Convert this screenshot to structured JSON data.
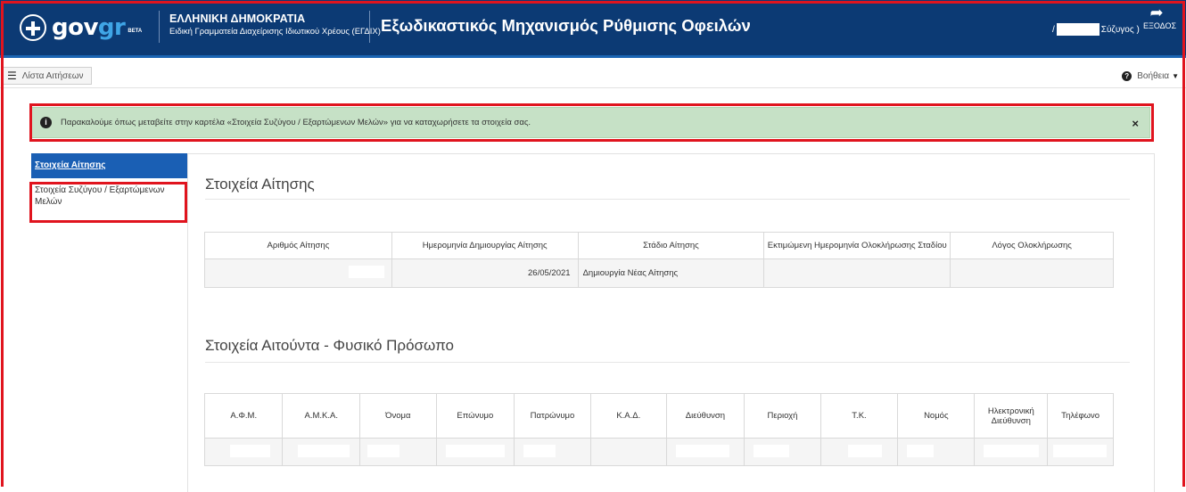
{
  "header": {
    "logo_gov": "gov",
    "logo_gr": "gr",
    "logo_beta": "BETA",
    "republic_title": "ΕΛΛΗΝΙΚΗ ΔΗΜΟΚΡΑΤΙΑ",
    "republic_subtitle": "Ειδική Γραμματεία Διαχείρισης Ιδιωτικού Χρέους (ΕΓΔΙΧ)",
    "app_title": "Εξωδικαστικός Μηχανισμός Ρύθμισης Οφειλών",
    "user_prefix": "/",
    "user_suffix": "Σύζυγος )",
    "logout_label": "ΕΞΟΔΟΣ",
    "logout_icon": "logout-icon",
    "colors": {
      "header_bg": "#0c3a74",
      "accent": "#1a5fb4",
      "highlight": "#e0141e"
    }
  },
  "toolbar": {
    "list_label": "Λίστα Αιτήσεων",
    "help_label": "Βοήθεια"
  },
  "alert": {
    "message": "Παρακαλούμε όπως μεταβείτε στην καρτέλα «Στοιχεία Συζύγου / Εξαρτώμενων Μελών» για να καταχωρήσετε τα στοιχεία σας.",
    "close": "×"
  },
  "sidebar": {
    "items": [
      {
        "label": "Στοιχεία Αίτησης",
        "active": true
      },
      {
        "label": "Στοιχεία Συζύγου / Εξαρτώμενων Μελών",
        "active": false
      }
    ]
  },
  "application": {
    "title": "Στοιχεία Αίτησης",
    "columns": [
      "Αριθμός Αίτησης",
      "Ημερομηνία Δημιουργίας Αίτησης",
      "Στάδιο Αίτησης",
      "Εκτιμώμενη Ημερομηνία Ολοκλήρωσης Σταδίου",
      "Λόγος Ολοκλήρωσης"
    ],
    "row": {
      "number": "",
      "created": "26/05/2021",
      "stage": "Δημιουργία Νέας Αίτησης",
      "estimated": "",
      "reason": ""
    }
  },
  "applicant": {
    "title": "Στοιχεία Αιτούντα - Φυσικό Πρόσωπο",
    "columns": [
      "Α.Φ.Μ.",
      "Α.Μ.Κ.Α.",
      "Όνομα",
      "Επώνυμο",
      "Πατρώνυμο",
      "Κ.Α.Δ.",
      "Διεύθυνση",
      "Περιοχή",
      "Τ.Κ.",
      "Νομός",
      "Ηλεκτρονική Διεύθυνση",
      "Τηλέφωνο"
    ]
  }
}
